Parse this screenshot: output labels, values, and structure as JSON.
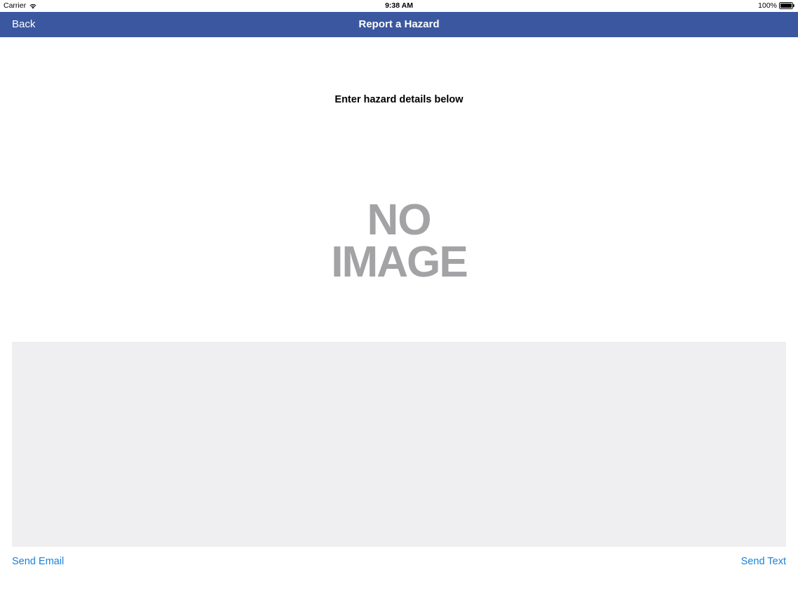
{
  "status_bar": {
    "carrier": "Carrier",
    "time": "9:38 AM",
    "battery": "100%",
    "wifi_icon": "wifi-icon",
    "battery_icon": "battery-icon"
  },
  "nav": {
    "back_label": "Back",
    "title": "Report a Hazard",
    "background_color": "#3a57a0"
  },
  "content": {
    "prompt": "Enter hazard details below",
    "placeholder_image": {
      "line1": "NO",
      "line2": "IMAGE"
    },
    "details_field": {
      "value": "",
      "placeholder": ""
    }
  },
  "actions": {
    "send_email_label": "Send Email",
    "send_text_label": "Send Text",
    "link_color": "#1a82d8"
  }
}
